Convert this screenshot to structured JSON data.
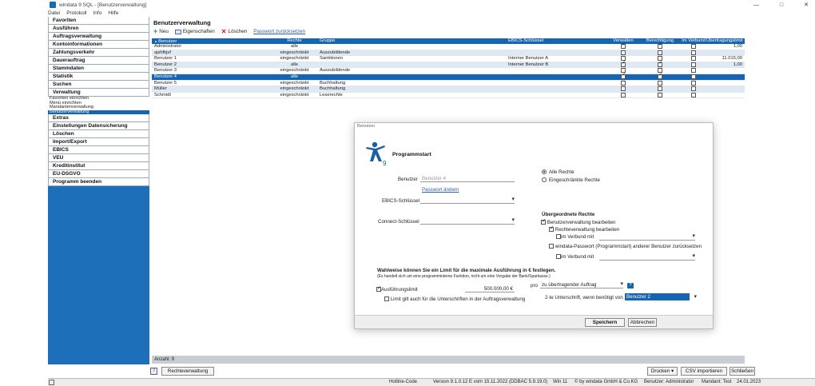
{
  "window": {
    "title": "windata 9 SQL - [Benutzerverwaltung]",
    "controls": [
      "—",
      "□",
      "✕"
    ]
  },
  "menu": [
    "Datei",
    "Protokoll",
    "Info",
    "Hilfe"
  ],
  "sidebar": {
    "sections_top": [
      "Favoriten",
      "Ausführen",
      "Auftragsverwaltung",
      "Kontoinformationen",
      "Zahlungsverkehr",
      "Dauerauftrag",
      "Stammdaten",
      "Statistik",
      "Suchen",
      "Verwaltung"
    ],
    "verwaltung_items": [
      "Favoriten einrichten",
      "Menü einrichten",
      "Mandantenverwaltung",
      "Benutzerverwaltung"
    ],
    "active_item": "Benutzerverwaltung",
    "sections_bottom": [
      "Extras",
      "Einstellungen Datensicherung",
      "Löschen",
      "Import/Export",
      "EBICS",
      "VEU",
      "Kreditinstitut",
      "EU-DSGVO",
      "Programm beenden"
    ]
  },
  "main": {
    "title": "Benutzerverwaltung",
    "toolbar": {
      "new_label": "Neu",
      "props_label": "Eigenschaften",
      "delete_label": "Löschen",
      "reset_pw_label": "Passwort zurücksetzen"
    },
    "columns": [
      "Benutzer",
      "Rechte",
      "Gruppe",
      "EBICS-Schlüssel",
      "Verwalten",
      "Berechtigung",
      "Im Verbund",
      "Übertragungslimit"
    ],
    "rows": [
      {
        "name": "Administrator",
        "rights": "alle",
        "group": "",
        "ebics": "",
        "verwalten": true,
        "berechtigung": true,
        "verbund": false,
        "limit": "1,00"
      },
      {
        "name": "ajshfkjsf",
        "rights": "eingeschränkt",
        "group": "Auszubildende",
        "ebics": "",
        "verwalten": false,
        "berechtigung": false,
        "verbund": false,
        "limit": ""
      },
      {
        "name": "Benutzer 1",
        "rights": "eingeschränkt",
        "group": "Sanktionen",
        "ebics": "Interner Benutzer A",
        "verwalten": false,
        "berechtigung": false,
        "verbund": false,
        "limit": "11.015,00"
      },
      {
        "name": "Benutzer 2",
        "rights": "alle",
        "group": "",
        "ebics": "Interner Benutzer B",
        "verwalten": true,
        "berechtigung": true,
        "verbund": false,
        "limit": "1,00"
      },
      {
        "name": "Benutzer 3",
        "rights": "eingeschränkt",
        "group": "Auszubildende",
        "ebics": "",
        "verwalten": false,
        "berechtigung": false,
        "verbund": false,
        "limit": ""
      },
      {
        "name": "Benutzer 4",
        "rights": "alle",
        "group": "",
        "ebics": "",
        "verwalten": true,
        "berechtigung": true,
        "verbund": false,
        "limit": ""
      },
      {
        "name": "Benutzer 5",
        "rights": "eingeschränkt",
        "group": "Buchhaltung",
        "ebics": "",
        "verwalten": false,
        "berechtigung": false,
        "verbund": false,
        "limit": ""
      },
      {
        "name": "Müller",
        "rights": "eingeschränkt",
        "group": "Buchhaltung",
        "ebics": "",
        "verwalten": false,
        "berechtigung": false,
        "verbund": false,
        "limit": ""
      },
      {
        "name": "Schmidt",
        "rights": "eingeschränkt",
        "group": "Leserechte",
        "ebics": "",
        "verwalten": false,
        "berechtigung": false,
        "verbund": false,
        "limit": ""
      }
    ],
    "selected_row": 5,
    "count_label": "Anzahl: 9"
  },
  "actions": {
    "rights_button": "Rechteverwaltung",
    "print_button": "Drucken",
    "csv_button": "CSV importieren",
    "close_button": "Schließen"
  },
  "statusbar": {
    "hotline": "Hotline-Code",
    "version": "Version 9.1.0.12 E vom 15.11.2022 (DDBAC 5.9.19.0)",
    "os": "Win 11",
    "copyright": "© by windata GmbH & Co.KG",
    "user": "Benutzer: Administrator",
    "mandant": "Mandant: Test",
    "date": "24.01.2023"
  },
  "dialog": {
    "title": "Benutzer",
    "heading": "Programmstart",
    "logo_text": "9",
    "user_label": "Benutzer",
    "user_value": "Benutzer 4",
    "change_pw_link": "Passwort ändern",
    "ebics_label": "EBICS-Schlüssel",
    "connect_label": "Connect-Schlüssel",
    "radio_all": "Alle Rechte",
    "radio_limited": "Eingeschränkte Rechte",
    "rights_heading": "Übergeordnete Rechte",
    "cb_user_admin": "Benutzerverwaltung bearbeiten",
    "cb_rights_admin": "Rechteverwaltung bearbeiten",
    "cb_verbund1": "im Verbund mit",
    "cb_reset_pw": "windata-Passwort (Programmstart) anderer Benutzer zurücksetzen",
    "cb_verbund2": "im Verbund mit",
    "limit_heading": "Wahlweise können Sie ein Limit für die maximale Ausführung in € festlegen.",
    "limit_note": "(Es handelt sich um eine programminterne Funktion, nicht um eine Vorgabe der Bank/Sparkasse.)",
    "cb_exec_limit": "Ausführungslimit",
    "limit_value": "500.000,00 €",
    "pro_label": "pro",
    "pro_value": "zu übertragender Auftrag",
    "cb_signature_limit": "Limit gilt auch für die Unterschriften in der Auftragsverwaltung",
    "second_sig_label": "2-te Unterschrift, wenn benötigt von",
    "second_sig_value": "Benutzer 2",
    "save_button": "Speichern",
    "cancel_button": "Abbrechen",
    "help_glyph": "?"
  }
}
